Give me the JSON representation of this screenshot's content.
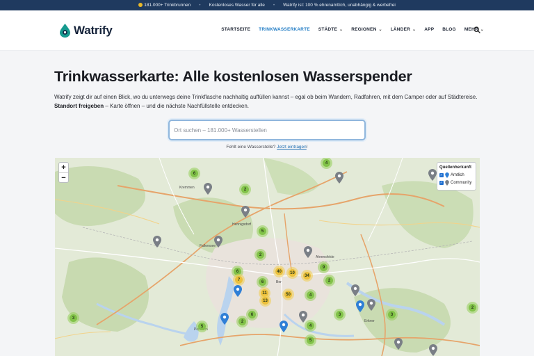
{
  "topbar": {
    "items": [
      "181.000+ Trinkbrunnen",
      "Kostenloses Wasser für alle",
      "Watrify ist: 100 % ehrenamtlich, unabhängig & werbefrei"
    ]
  },
  "header": {
    "logo_text": "Watrify",
    "nav": [
      {
        "label": "STARTSEITE",
        "active": false,
        "dropdown": false
      },
      {
        "label": "TRINKWASSERKARTE",
        "active": true,
        "dropdown": false
      },
      {
        "label": "STÄDTE",
        "active": false,
        "dropdown": true
      },
      {
        "label": "REGIONEN",
        "active": false,
        "dropdown": true
      },
      {
        "label": "LÄNDER",
        "active": false,
        "dropdown": true
      },
      {
        "label": "APP",
        "active": false,
        "dropdown": false
      },
      {
        "label": "BLOG",
        "active": false,
        "dropdown": false
      },
      {
        "label": "MEHR",
        "active": false,
        "dropdown": true
      }
    ]
  },
  "main": {
    "title": "Trinkwasserkarte: Alle kostenlosen Wasserspender",
    "intro_text": "Watrify zeigt dir auf einen Blick, wo du unterwegs deine Trinkflasche nachhaltig auffüllen kannst – egal ob beim Wandern, Radfahren, mit dem Camper oder auf Städtereise.",
    "intro_bold": "Standort freigeben",
    "intro_tail": "– Karte öffnen – und die nächste Nachfüllstelle entdecken.",
    "search_placeholder": "Ort suchen – 181.000+ Wasserstellen",
    "missing_text": "Fehlt eine Wasserstelle?",
    "missing_link": "Jetzt eintragen",
    "missing_suffix": "!"
  },
  "map": {
    "zoom_in": "+",
    "zoom_out": "−",
    "legend_title": "Quellenherkunft",
    "legend_items": [
      "Amtlich",
      "Community"
    ],
    "colors": {
      "official_pin": "#2f7fd6",
      "community_pin": "#7a7f86",
      "cluster_green": "#7cc043",
      "cluster_yellow": "#ebbd33"
    },
    "clusters": [
      {
        "label": "4",
        "color": "green"
      },
      {
        "label": "6",
        "color": "green"
      },
      {
        "label": "2",
        "color": "green"
      },
      {
        "label": "5",
        "color": "green"
      },
      {
        "label": "2",
        "color": "green"
      },
      {
        "label": "6",
        "color": "green"
      },
      {
        "label": "40",
        "color": "yellow"
      },
      {
        "label": "10",
        "color": "yellow"
      },
      {
        "label": "34",
        "color": "yellow"
      },
      {
        "label": "9",
        "color": "green"
      },
      {
        "label": "7",
        "color": "yellow"
      },
      {
        "label": "6",
        "color": "green"
      },
      {
        "label": "2",
        "color": "green"
      },
      {
        "label": "11",
        "color": "yellow"
      },
      {
        "label": "13",
        "color": "yellow"
      },
      {
        "label": "50",
        "color": "yellow"
      },
      {
        "label": "4",
        "color": "green"
      },
      {
        "label": "3",
        "color": "green"
      },
      {
        "label": "6",
        "color": "green"
      },
      {
        "label": "2",
        "color": "green"
      },
      {
        "label": "5",
        "color": "green"
      },
      {
        "label": "4",
        "color": "green"
      },
      {
        "label": "5",
        "color": "green"
      },
      {
        "label": "3",
        "color": "green"
      },
      {
        "label": "3",
        "color": "green"
      },
      {
        "label": "2",
        "color": "green"
      }
    ],
    "places": [
      "Kremmen",
      "Falkensee",
      "Ber",
      "Potsdam",
      "Hennigsdorf",
      "Ahrensfelde",
      "Erkner"
    ]
  }
}
